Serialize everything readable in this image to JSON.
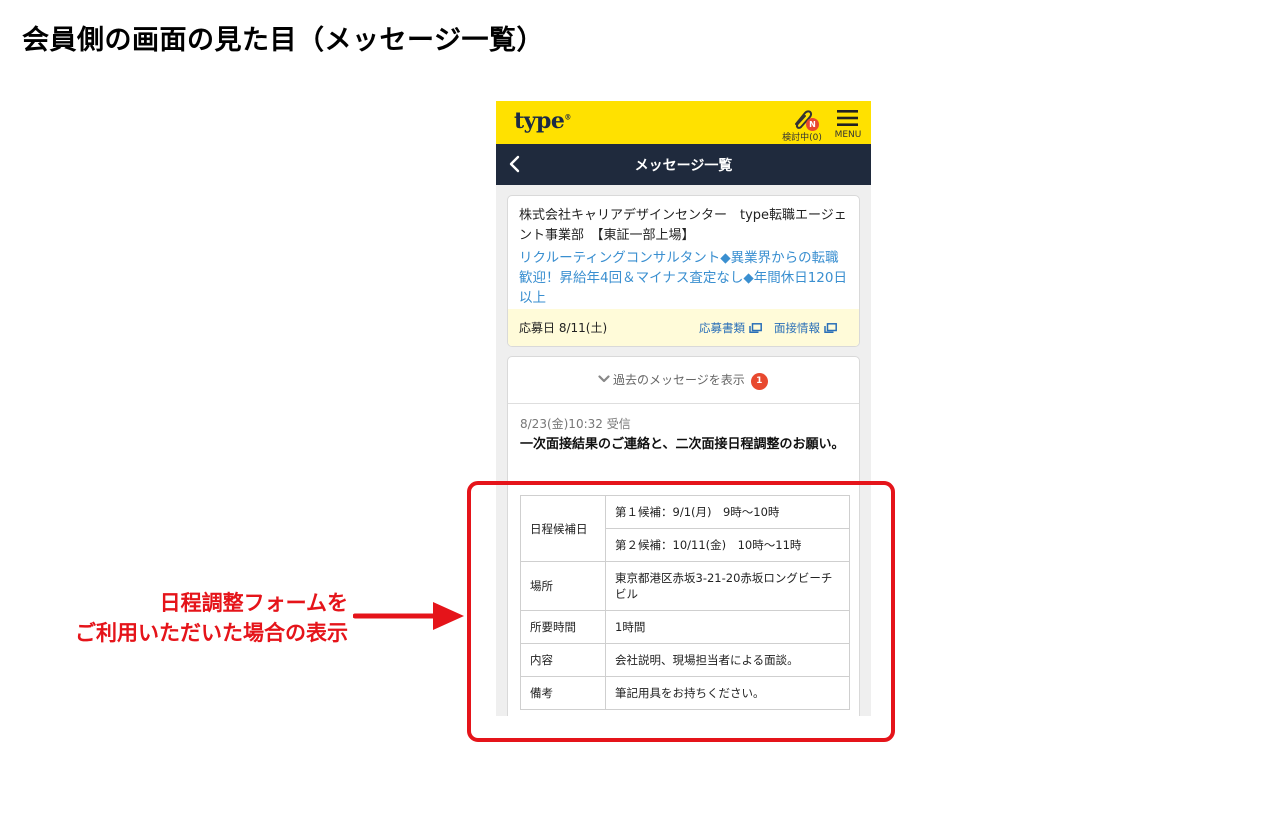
{
  "slide": {
    "title": "会員側の画面の見た目（メッセージ一覧）",
    "annotation_line1": "日程調整フォームを",
    "annotation_line2": "ご利用いただいた場合の表示"
  },
  "header": {
    "logo": "type",
    "logo_mark": "®",
    "clip_label": "検討中(0)",
    "clip_badge": "N",
    "menu_label": "MENU"
  },
  "nav": {
    "title": "メッセージ一覧"
  },
  "application": {
    "company": "株式会社キャリアデザインセンター　type転職エージェント事業部　【東証一部上場】",
    "job_title": "リクルーティングコンサルタント◆異業界からの転職歓迎！昇給年4回＆マイナス査定なし◆年間休日120日以上",
    "apply_date": "応募日 8/11(土)",
    "docs_link": "応募書類",
    "interview_link": "面接情報"
  },
  "messages": {
    "past_label": "過去のメッセージを表示",
    "past_count": "1",
    "meta": "8/23(金)10:32 受信",
    "subject": "一次面接結果のご連絡と、二次面接日程調整のお願い。",
    "schedule": {
      "date_label": "日程候補日",
      "candidate1": "第１候補：9/1(月)　9時～10時",
      "candidate2": "第２候補：10/11(金)　10時～11時",
      "place_label": "場所",
      "place": "東京都港区赤坂3-21-20赤坂ロングビーチビル",
      "duration_label": "所要時間",
      "duration": "1時間",
      "content_label": "内容",
      "content": "会社説明、現場担当者による面談。",
      "notes_label": "備考",
      "notes": "筆記用具をお持ちください。"
    }
  },
  "colors": {
    "header_yellow": "#ffe100",
    "navbar_navy": "#1f2a3d",
    "link_blue": "#3a8fd0",
    "highlight_red": "#e5141a",
    "badge_red": "#e8492f"
  }
}
